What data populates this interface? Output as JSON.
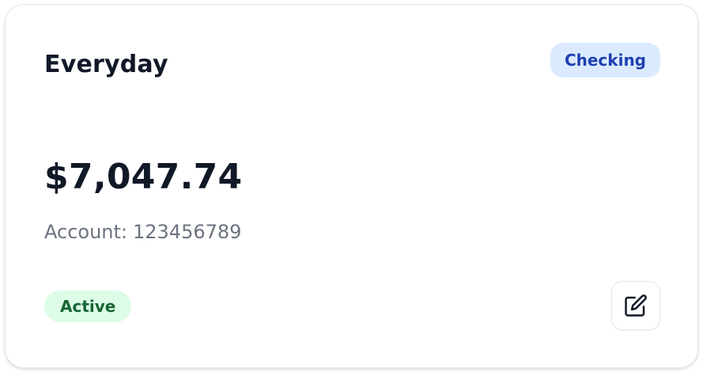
{
  "card": {
    "name": "Everyday",
    "type_badge": "Checking",
    "balance": "$7,047.74",
    "account_label": "Account:",
    "account_number": "123456789",
    "status": "Active",
    "edit_icon": "edit-icon"
  },
  "colors": {
    "type_badge_bg": "#dbeafe",
    "type_badge_text": "#1e40af",
    "status_bg": "#dcfce7",
    "status_text": "#166534"
  }
}
